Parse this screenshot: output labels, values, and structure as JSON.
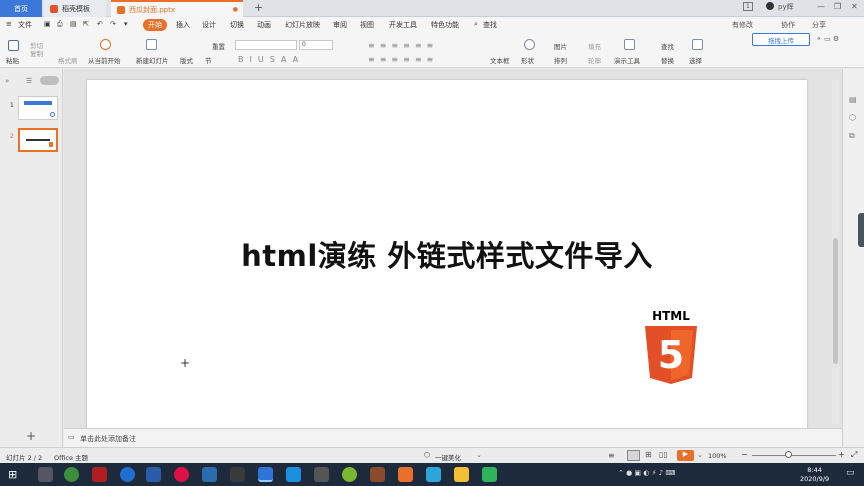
{
  "tabs": {
    "home": "首页",
    "template": "稻壳模板",
    "file": "西瓜封面.pptx",
    "file_badge": "1",
    "user": "py辉"
  },
  "menu": {
    "file": "文件",
    "items": [
      "开始",
      "插入",
      "设计",
      "切换",
      "动画",
      "幻灯片放映",
      "审阅",
      "视图",
      "开发工具",
      "特色功能"
    ],
    "search": "查找",
    "unsaved": "有修改",
    "collab": "协作",
    "share": "分享"
  },
  "ribbon": {
    "paste": "粘贴",
    "cut": "剪切",
    "copy": "复制",
    "format_painter": "格式刷",
    "from_current": "从当前开始",
    "new_slide": "新建幻灯片",
    "layout": "版式",
    "section": "节",
    "reset": "重置",
    "font_size": "0",
    "textbox": "文本框",
    "shape": "形状",
    "picture": "图片",
    "arrange": "排列",
    "fill": "填充",
    "outline": "轮廓",
    "present_tools": "演示工具",
    "find": "查找",
    "replace": "替换",
    "select": "选择",
    "upload": "拖拽上传"
  },
  "slide": {
    "title": "html演练 外链式样式文件导入",
    "logo_text": "HTML",
    "logo_num": "5"
  },
  "thumbnails": [
    "1",
    "2"
  ],
  "notes": {
    "placeholder": "单击此处添加备注"
  },
  "status": {
    "slide_count": "幻灯片 2 / 2",
    "theme": "Office 主题",
    "beautify": "一键美化",
    "zoom": "100%"
  },
  "clock": {
    "time": "8:44",
    "date": "2020/9/9"
  }
}
